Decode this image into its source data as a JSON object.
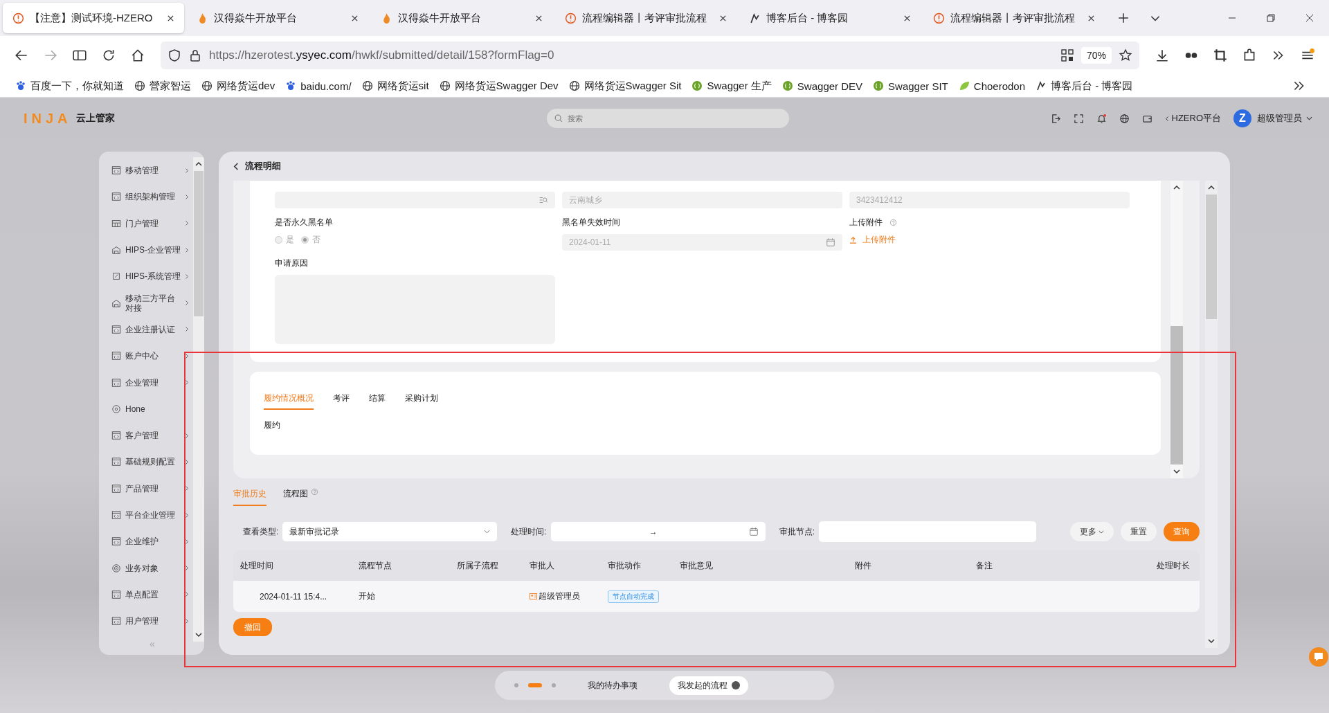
{
  "browser": {
    "tabs": [
      {
        "title": "【注意】测试环境-HZERO",
        "selected": true,
        "kind": "warning"
      },
      {
        "title": "汉得焱牛开放平台",
        "selected": false,
        "kind": "flame"
      },
      {
        "title": "汉得焱牛开放平台",
        "selected": false,
        "kind": "flame"
      },
      {
        "title": "流程编辑器丨考评审批流程",
        "selected": false,
        "kind": "warning"
      },
      {
        "title": "博客后台 - 博客园",
        "selected": false,
        "kind": "runner"
      },
      {
        "title": "流程编辑器丨考评审批流程",
        "selected": false,
        "kind": "warning"
      }
    ],
    "url_prefix": "https://hzerotest.",
    "url_domain": "ysyec.com",
    "url_path": "/hwkf/submitted/detail/158?formFlag=0",
    "zoom": "70%",
    "bookmarks": [
      {
        "label": "百度一下，你就知道",
        "kind": "paw"
      },
      {
        "label": "營家智运",
        "kind": "globe"
      },
      {
        "label": "网络货运dev",
        "kind": "globe"
      },
      {
        "label": "baidu.com/",
        "kind": "paw"
      },
      {
        "label": "网络货运sit",
        "kind": "globe"
      },
      {
        "label": "网络货运Swagger Dev",
        "kind": "globe"
      },
      {
        "label": "网络货运Swagger Sit",
        "kind": "globe"
      },
      {
        "label": "Swagger 生产",
        "kind": "swagger"
      },
      {
        "label": "Swagger DEV",
        "kind": "swagger"
      },
      {
        "label": "Swagger SIT",
        "kind": "swagger"
      },
      {
        "label": "Choerodon",
        "kind": "leaf"
      },
      {
        "label": "博客后台 - 博客园",
        "kind": "runner"
      }
    ]
  },
  "app": {
    "logo": "INJA",
    "logo_text": "云上管家",
    "search": {
      "placeholder": "搜索"
    },
    "platform": "HZERO平台",
    "user": "超级管理员",
    "avatar": "Z"
  },
  "sidebar": {
    "items": [
      {
        "label": "移动管理",
        "kind": "app",
        "arrow": true
      },
      {
        "label": "组织架构管理",
        "kind": "app",
        "arrow": true
      },
      {
        "label": "门户管理",
        "kind": "table",
        "arrow": true
      },
      {
        "label": "HIPS-企业管理",
        "kind": "building",
        "arrow": true
      },
      {
        "label": "HIPS-系统管理",
        "kind": "edit",
        "arrow": true
      },
      {
        "label": "移动三方平台对接",
        "kind": "building",
        "arrow": true
      },
      {
        "label": "企业注册认证",
        "kind": "app",
        "arrow": true
      },
      {
        "label": "账户中心",
        "kind": "app",
        "arrow": true
      },
      {
        "label": "企业管理",
        "kind": "app",
        "arrow": true
      },
      {
        "label": "Hone",
        "kind": "hub",
        "arrow": false
      },
      {
        "label": "客户管理",
        "kind": "app",
        "arrow": true
      },
      {
        "label": "基础规则配置",
        "kind": "app",
        "arrow": true
      },
      {
        "label": "产品管理",
        "kind": "app",
        "arrow": true
      },
      {
        "label": "平台企业管理",
        "kind": "app",
        "arrow": true
      },
      {
        "label": "企业维护",
        "kind": "app",
        "arrow": true
      },
      {
        "label": "业务对象",
        "kind": "target",
        "arrow": true
      },
      {
        "label": "单点配置",
        "kind": "app",
        "arrow": true
      },
      {
        "label": "用户管理",
        "kind": "app",
        "arrow": true
      }
    ],
    "collapse": "«"
  },
  "page": {
    "title": "流程明细",
    "form": {
      "fields": [
        {
          "kind": "search"
        },
        {
          "kind": "text",
          "value": "云南城乡"
        },
        {
          "kind": "text",
          "value": "3423412412"
        }
      ],
      "blacklist": {
        "label": "是否永久黑名单",
        "options": [
          {
            "label": "是",
            "selected": false
          },
          {
            "label": "否",
            "selected": true
          }
        ]
      },
      "expiry": {
        "label": "黑名单失效时间",
        "value": "2024-01-11"
      },
      "upload": {
        "label": "上传附件",
        "button": "上传附件"
      },
      "reason": {
        "label": "申请原因"
      }
    },
    "inner_tabs": [
      {
        "label": "履约情况概况",
        "selected": true
      },
      {
        "label": "考评",
        "selected": false
      },
      {
        "label": "结算",
        "selected": false
      },
      {
        "label": "采购计划",
        "selected": false
      }
    ],
    "inner_content": "履约",
    "history_tabs": [
      {
        "label": "审批历史",
        "selected": true,
        "help": false
      },
      {
        "label": "流程图",
        "selected": false,
        "help": true
      }
    ],
    "filters": {
      "type_label": "查看类型:",
      "type_value": "最新审批记录",
      "time_label": "处理时间:",
      "range_sep": "→",
      "node_label": "审批节点:"
    },
    "buttons": [
      {
        "label": "更多",
        "kind": "dropdown"
      },
      {
        "label": "重置",
        "kind": "plain"
      },
      {
        "label": "查询",
        "kind": "primary"
      }
    ],
    "table": {
      "columns": [
        "处理时间",
        "流程节点",
        "所属子流程",
        "审批人",
        "审批动作",
        "审批意见",
        "附件",
        "备注",
        "处理时长"
      ],
      "rows": [
        {
          "time": "2024-01-11 15:4...",
          "node": "开始",
          "approver": "超级管理员",
          "action": "节点自动完成"
        }
      ]
    },
    "withdraw": "撤回"
  },
  "dock": {
    "dots": [
      {
        "selected": false
      },
      {
        "selected": true
      },
      {
        "selected": false
      }
    ],
    "items": [
      {
        "label": "我的待办事项",
        "selected": false,
        "badge": false
      },
      {
        "label": "我发起的流程",
        "selected": true,
        "badge": true
      }
    ]
  }
}
